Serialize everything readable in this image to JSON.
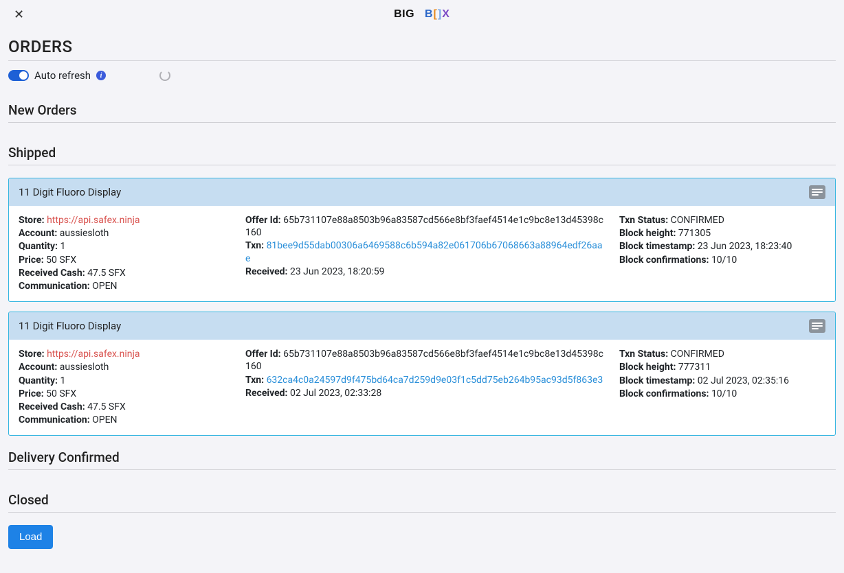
{
  "header": {
    "logo_big": "BIG",
    "logo_b": "B",
    "logo_bracket1": "[",
    "logo_bracket2": "]",
    "logo_x": "X"
  },
  "page": {
    "title": "ORDERS",
    "auto_refresh_label": "Auto refresh",
    "load_button": "Load"
  },
  "sections": {
    "new_orders": "New Orders",
    "shipped": "Shipped",
    "delivery_confirmed": "Delivery Confirmed",
    "closed": "Closed"
  },
  "labels": {
    "store": "Store:",
    "account": "Account:",
    "quantity": "Quantity:",
    "price": "Price:",
    "received_cash": "Received Cash:",
    "communication": "Communication:",
    "offer_id": "Offer Id:",
    "txn": "Txn:",
    "received": "Received:",
    "txn_status": "Txn Status:",
    "block_height": "Block height:",
    "block_timestamp": "Block timestamp:",
    "block_confirmations": "Block confirmations:"
  },
  "orders": [
    {
      "title": "11 Digit Fluoro Display",
      "store": "https://api.safex.ninja",
      "account": "aussiesloth",
      "quantity": "1",
      "price": "50 SFX",
      "received_cash": "47.5 SFX",
      "communication": "OPEN",
      "offer_id": "65b731107e88a8503b96a83587cd566e8bf3faef4514e1c9bc8e13d45398c160",
      "txn": "81bee9d55dab00306a6469588c6b594a82e061706b67068663a88964edf26aae",
      "received": "23 Jun 2023, 18:20:59",
      "txn_status": "CONFIRMED",
      "block_height": "771305",
      "block_timestamp": "23 Jun 2023, 18:23:40",
      "block_confirmations": "10/10"
    },
    {
      "title": "11 Digit Fluoro Display",
      "store": "https://api.safex.ninja",
      "account": "aussiesloth",
      "quantity": "1",
      "price": "50 SFX",
      "received_cash": "47.5 SFX",
      "communication": "OPEN",
      "offer_id": "65b731107e88a8503b96a83587cd566e8bf3faef4514e1c9bc8e13d45398c160",
      "txn": "632ca4c0a24597d9f475bd64ca7d259d9e03f1c5dd75eb264b95ac93d5f863e3",
      "received": "02 Jul 2023, 02:33:28",
      "txn_status": "CONFIRMED",
      "block_height": "777311",
      "block_timestamp": "02 Jul 2023, 02:35:16",
      "block_confirmations": "10/10"
    }
  ]
}
